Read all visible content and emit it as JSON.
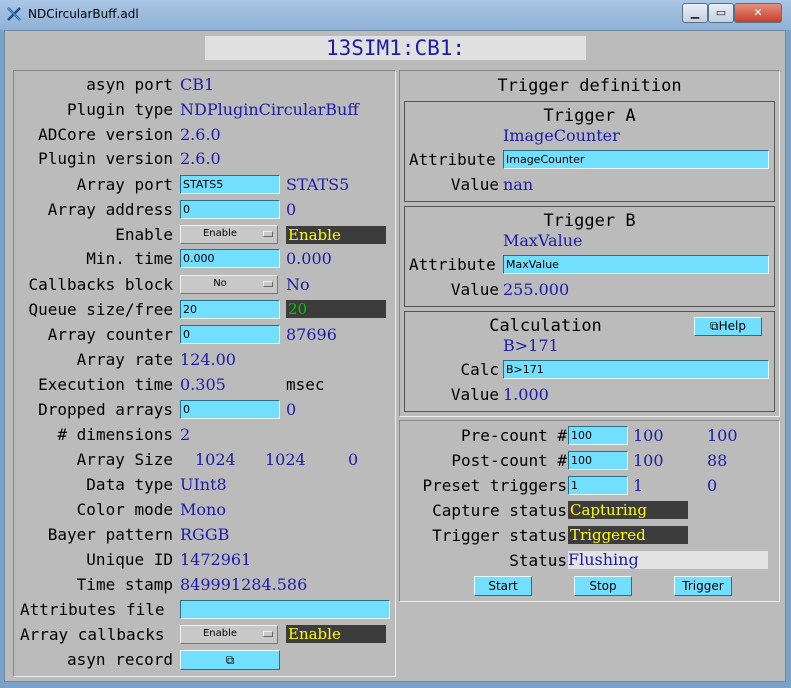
{
  "window": {
    "title": "NDCircularBuff.adl",
    "min_label": "▁",
    "max_label": "▭",
    "close_label": "✕"
  },
  "header": {
    "prefix": "13SIM1:CB1:"
  },
  "left": {
    "asyn_port": {
      "label": "asyn port",
      "value": "CB1"
    },
    "plugin_type": {
      "label": "Plugin type",
      "value": "NDPluginCircularBuff"
    },
    "adcore_version": {
      "label": "ADCore version",
      "value": "2.6.0"
    },
    "plugin_version": {
      "label": "Plugin version",
      "value": "2.6.0"
    },
    "array_port": {
      "label": "Array port",
      "input": "STATS5",
      "value": "STATS5"
    },
    "array_address": {
      "label": "Array address",
      "input": "0",
      "value": "0"
    },
    "enable": {
      "label": "Enable",
      "menu": "Enable",
      "value": "Enable"
    },
    "min_time": {
      "label": "Min. time",
      "input": "0.000",
      "value": "0.000"
    },
    "callbacks_block": {
      "label": "Callbacks block",
      "menu": "No",
      "value": "No"
    },
    "queue": {
      "label": "Queue size/free",
      "input": "20",
      "value": "20"
    },
    "array_counter": {
      "label": "Array counter",
      "input": "0",
      "value": "87696"
    },
    "array_rate": {
      "label": "Array rate",
      "value": "124.00"
    },
    "execution_time": {
      "label": "Execution time",
      "value": "0.305",
      "unit": "msec"
    },
    "dropped_arrays": {
      "label": "Dropped arrays",
      "input": "0",
      "value": "0"
    },
    "dimensions": {
      "label": "# dimensions",
      "value": "2"
    },
    "array_size": {
      "label": "Array Size",
      "v1": "1024",
      "v2": "1024",
      "v3": "0"
    },
    "data_type": {
      "label": "Data type",
      "value": "UInt8"
    },
    "color_mode": {
      "label": "Color mode",
      "value": "Mono"
    },
    "bayer_pattern": {
      "label": "Bayer pattern",
      "value": "RGGB"
    },
    "unique_id": {
      "label": "Unique ID",
      "value": "1472961"
    },
    "time_stamp": {
      "label": "Time stamp",
      "value": "849991284.586"
    },
    "attributes_file": {
      "label": "Attributes file",
      "input": ""
    },
    "array_callbacks": {
      "label": "Array callbacks",
      "menu": "Enable",
      "value": "Enable"
    },
    "asyn_record": {
      "label": "asyn record",
      "button": "⧉"
    }
  },
  "trigger": {
    "title": "Trigger definition",
    "a": {
      "title": "Trigger A",
      "name": "ImageCounter",
      "attr_label": "Attribute",
      "attr_input": "ImageCounter",
      "value_label": "Value",
      "value": "nan"
    },
    "b": {
      "title": "Trigger B",
      "name": "MaxValue",
      "attr_label": "Attribute",
      "attr_input": "MaxValue",
      "value_label": "Value",
      "value": "255.000"
    },
    "calc": {
      "title": "Calculation",
      "help": "⧉Help",
      "expr": "B>171",
      "calc_label": "Calc",
      "calc_input": "B>171",
      "value_label": "Value",
      "value": "1.000"
    }
  },
  "capture": {
    "pre": {
      "label": "Pre-count #",
      "input": "100",
      "v1": "100",
      "v2": "100"
    },
    "post": {
      "label": "Post-count #",
      "input": "100",
      "v1": "100",
      "v2": "88"
    },
    "preset": {
      "label": "Preset triggers",
      "input": "1",
      "v1": "1",
      "v2": "0"
    },
    "capture_status": {
      "label": "Capture status",
      "value": "Capturing"
    },
    "trigger_status": {
      "label": "Trigger status",
      "value": "Triggered"
    },
    "status": {
      "label": "Status",
      "value": "Flushing"
    },
    "buttons": {
      "start": "Start",
      "stop": "Stop",
      "trigger": "Trigger"
    }
  },
  "colors": {
    "input_bg": "#73dfff",
    "readback": "#1c1ca8",
    "alarm_dark": "#3c3c3c",
    "alarm_yellow": "#ffff00",
    "alarm_green": "#00c800"
  }
}
